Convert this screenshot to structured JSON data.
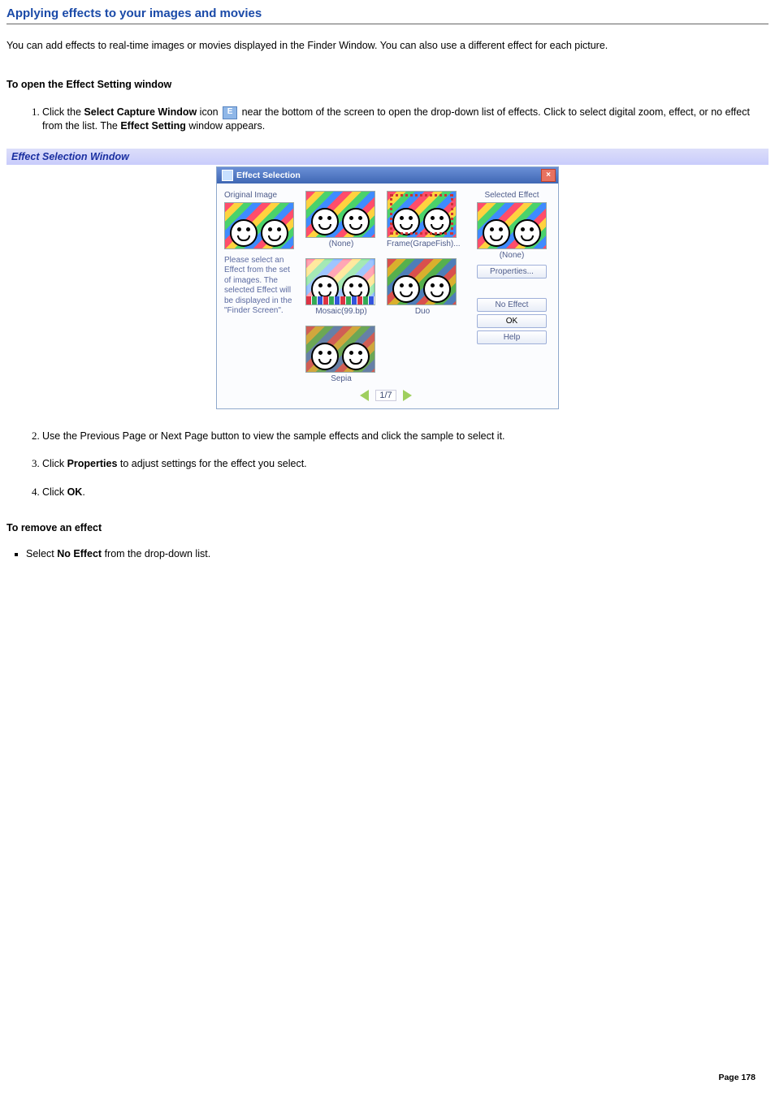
{
  "title": "Applying effects to your images and movies",
  "intro": "You can add effects to real-time images or movies displayed in the Finder Window. You can also use a different effect for each picture.",
  "sect1_hdr": "To open the Effect Setting window",
  "step1_a": "Click the ",
  "step1_b": "Select Capture Window",
  "step1_c": " icon ",
  "step1_d": " near the bottom of the screen to open the drop-down list of effects. Click to select digital zoom, effect, or no effect from the list. The ",
  "step1_e": "Effect Setting",
  "step1_f": " window appears.",
  "caption": "Effect Selection Window",
  "dialog": {
    "title": "Effect Selection",
    "orig_lbl": "Original Image",
    "sel_lbl": "Selected Effect",
    "left_desc": "Please select an Effect from the set of images. The selected Effect will be displayed in the \"Finder Screen\".",
    "thumbs": {
      "none": "(None)",
      "frame": "Frame(GrapeFish)...",
      "mosaic": "Mosaic(99.bp)",
      "duo": "Duo",
      "sepia": "Sepia"
    },
    "selected_cap": "(None)",
    "btn_prop": "Properties...",
    "btn_noeff": "No Effect",
    "btn_ok": "OK",
    "btn_help": "Help",
    "page": "1/7"
  },
  "step2": "Use the Previous Page or Next Page button to view the sample effects and click the sample to select it.",
  "step3_a": "Click ",
  "step3_b": "Properties",
  "step3_c": " to adjust settings for the effect you select.",
  "step4_a": "Click ",
  "step4_b": "OK",
  "step4_c": ".",
  "sect2_hdr": "To remove an effect",
  "bul_a": "Select ",
  "bul_b": "No Effect",
  "bul_c": " from the drop-down list.",
  "page_num": "Page 178"
}
